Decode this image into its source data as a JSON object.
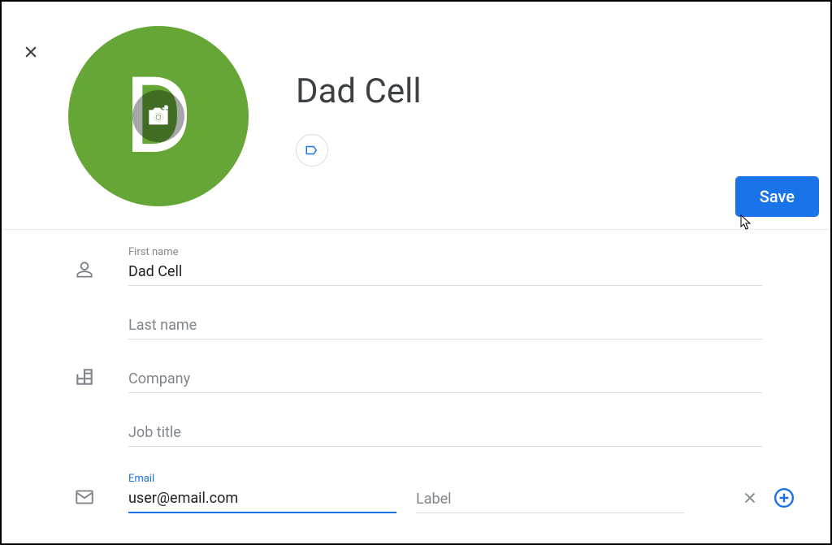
{
  "colors": {
    "accent": "#1a73e8",
    "avatar_bg": "#65a637"
  },
  "header": {
    "avatar_letter": "D",
    "contact_name": "Dad Cell",
    "save_label": "Save"
  },
  "form": {
    "first_name": {
      "label": "First name",
      "value": "Dad Cell"
    },
    "last_name": {
      "placeholder": "Last name",
      "value": ""
    },
    "company": {
      "placeholder": "Company",
      "value": ""
    },
    "job_title": {
      "placeholder": "Job title",
      "value": ""
    },
    "email": {
      "label": "Email",
      "value": "user@email.com"
    },
    "email_label": {
      "placeholder": "Label",
      "value": ""
    }
  }
}
